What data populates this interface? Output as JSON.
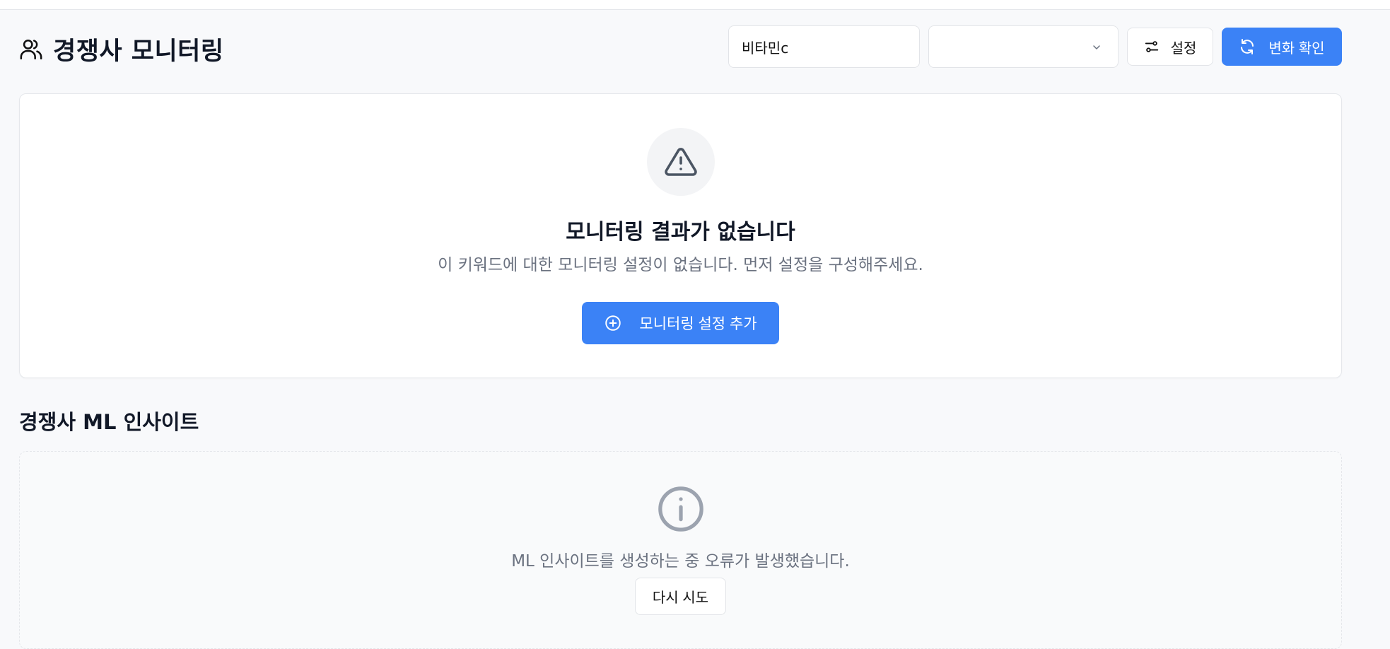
{
  "header": {
    "title": "경쟁사 모니터링",
    "keyword_value": "비타민c",
    "select_value": "",
    "settings_label": "설정",
    "refresh_label": "변화 확인"
  },
  "empty_state": {
    "title": "모니터링 결과가 없습니다",
    "description": "이 키워드에 대한 모니터링 설정이 없습니다. 먼저 설정을 구성해주세요.",
    "add_button_label": "모니터링 설정 추가"
  },
  "ml_section": {
    "title": "경쟁사 ML 인사이트",
    "error_message": "ML 인사이트를 생성하는 중 오류가 발생했습니다.",
    "retry_label": "다시 시도"
  },
  "colors": {
    "accent": "#3b82f6",
    "background": "#f8f9fb",
    "muted_text": "#6b7280"
  },
  "icons": [
    "users-icon",
    "chevron-down-icon",
    "sliders-icon",
    "refresh-icon",
    "warning-triangle-icon",
    "plus-circle-icon",
    "info-icon"
  ]
}
